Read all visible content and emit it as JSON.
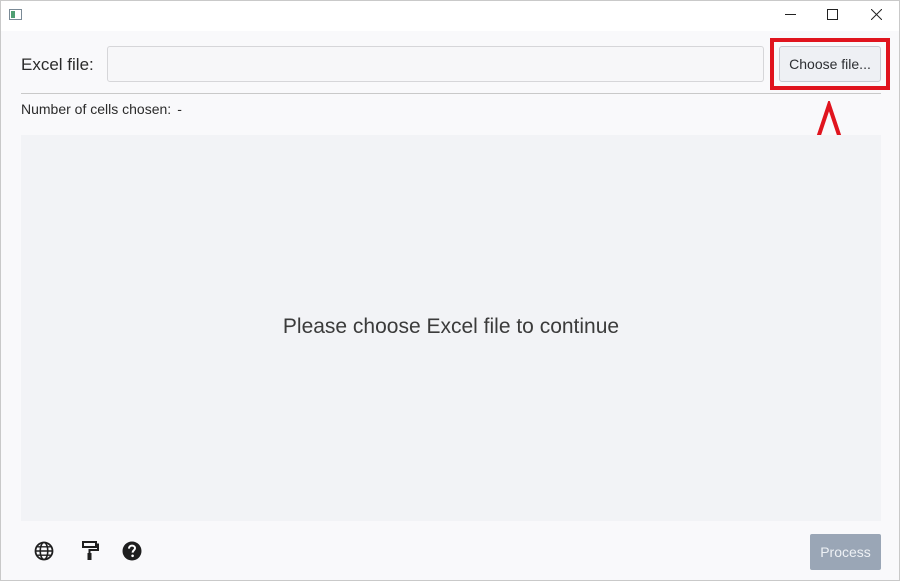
{
  "window": {
    "minimize_icon": "minimize-icon",
    "maximize_icon": "maximize-icon",
    "close_icon": "close-icon"
  },
  "file_row": {
    "label": "Excel file:",
    "input_value": "",
    "input_placeholder": "",
    "choose_button_label": "Choose file..."
  },
  "cells": {
    "label": "Number of cells chosen:",
    "value": "-"
  },
  "main": {
    "empty_message": "Please choose Excel file to continue"
  },
  "toolbar": {
    "icons": [
      "globe-icon",
      "paint-roller-icon",
      "help-icon"
    ]
  },
  "process_button": {
    "label": "Process",
    "enabled": false
  },
  "colors": {
    "annotation_red": "#e0141e",
    "process_disabled_bg": "#9aa6b6",
    "content_bg": "#f2f3f6"
  }
}
